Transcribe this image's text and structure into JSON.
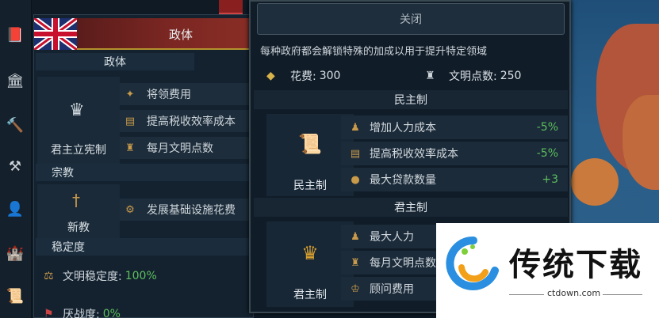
{
  "left_panel": {
    "header_title": "政体",
    "government_section": "政体",
    "current_government": "君主立宪制",
    "government_modifiers": [
      "将领费用",
      "提高税收效率成本",
      "每月文明点数"
    ],
    "religion_section": "宗教",
    "religion_name": "新教",
    "religion_modifiers": [
      "发展基础设施花费"
    ],
    "stability_section": "稳定度",
    "civ_stability_label": "文明稳定度:",
    "civ_stability_value": "100%",
    "war_weariness_label": "厌战度:",
    "war_weariness_value": "0%"
  },
  "popup": {
    "close_label": "关闭",
    "description": "每种政府都会解锁特殊的加成以用于提升特定领域",
    "cost_label": "花费:",
    "cost_value": "300",
    "civ_points_label": "文明点数:",
    "civ_points_value": "250",
    "governments": [
      {
        "section_title": "民主制",
        "name": "民主制",
        "emblem": "scroll-icon",
        "modifiers": [
          {
            "label": "增加人力成本",
            "value": "-5%",
            "icon": "manpower-icon"
          },
          {
            "label": "提高税收效率成本",
            "value": "-5%",
            "icon": "tax-icon"
          },
          {
            "label": "最大贷款数量",
            "value": "+3",
            "icon": "loan-icon"
          }
        ]
      },
      {
        "section_title": "君主制",
        "name": "君主制",
        "emblem": "crown-icon",
        "modifiers": [
          {
            "label": "最大人力",
            "value": "",
            "icon": "manpower-icon"
          },
          {
            "label": "每月文明点数",
            "value": "",
            "icon": "civ-point-icon"
          },
          {
            "label": "顾问费用",
            "value": "",
            "icon": "advisor-icon"
          }
        ]
      }
    ]
  },
  "watermark": {
    "title": "传统下载",
    "url": "ctdown.com"
  },
  "colors": {
    "positive": "#5cbf5c",
    "header_red": "#7a2622",
    "gold_border": "#b4922d"
  }
}
